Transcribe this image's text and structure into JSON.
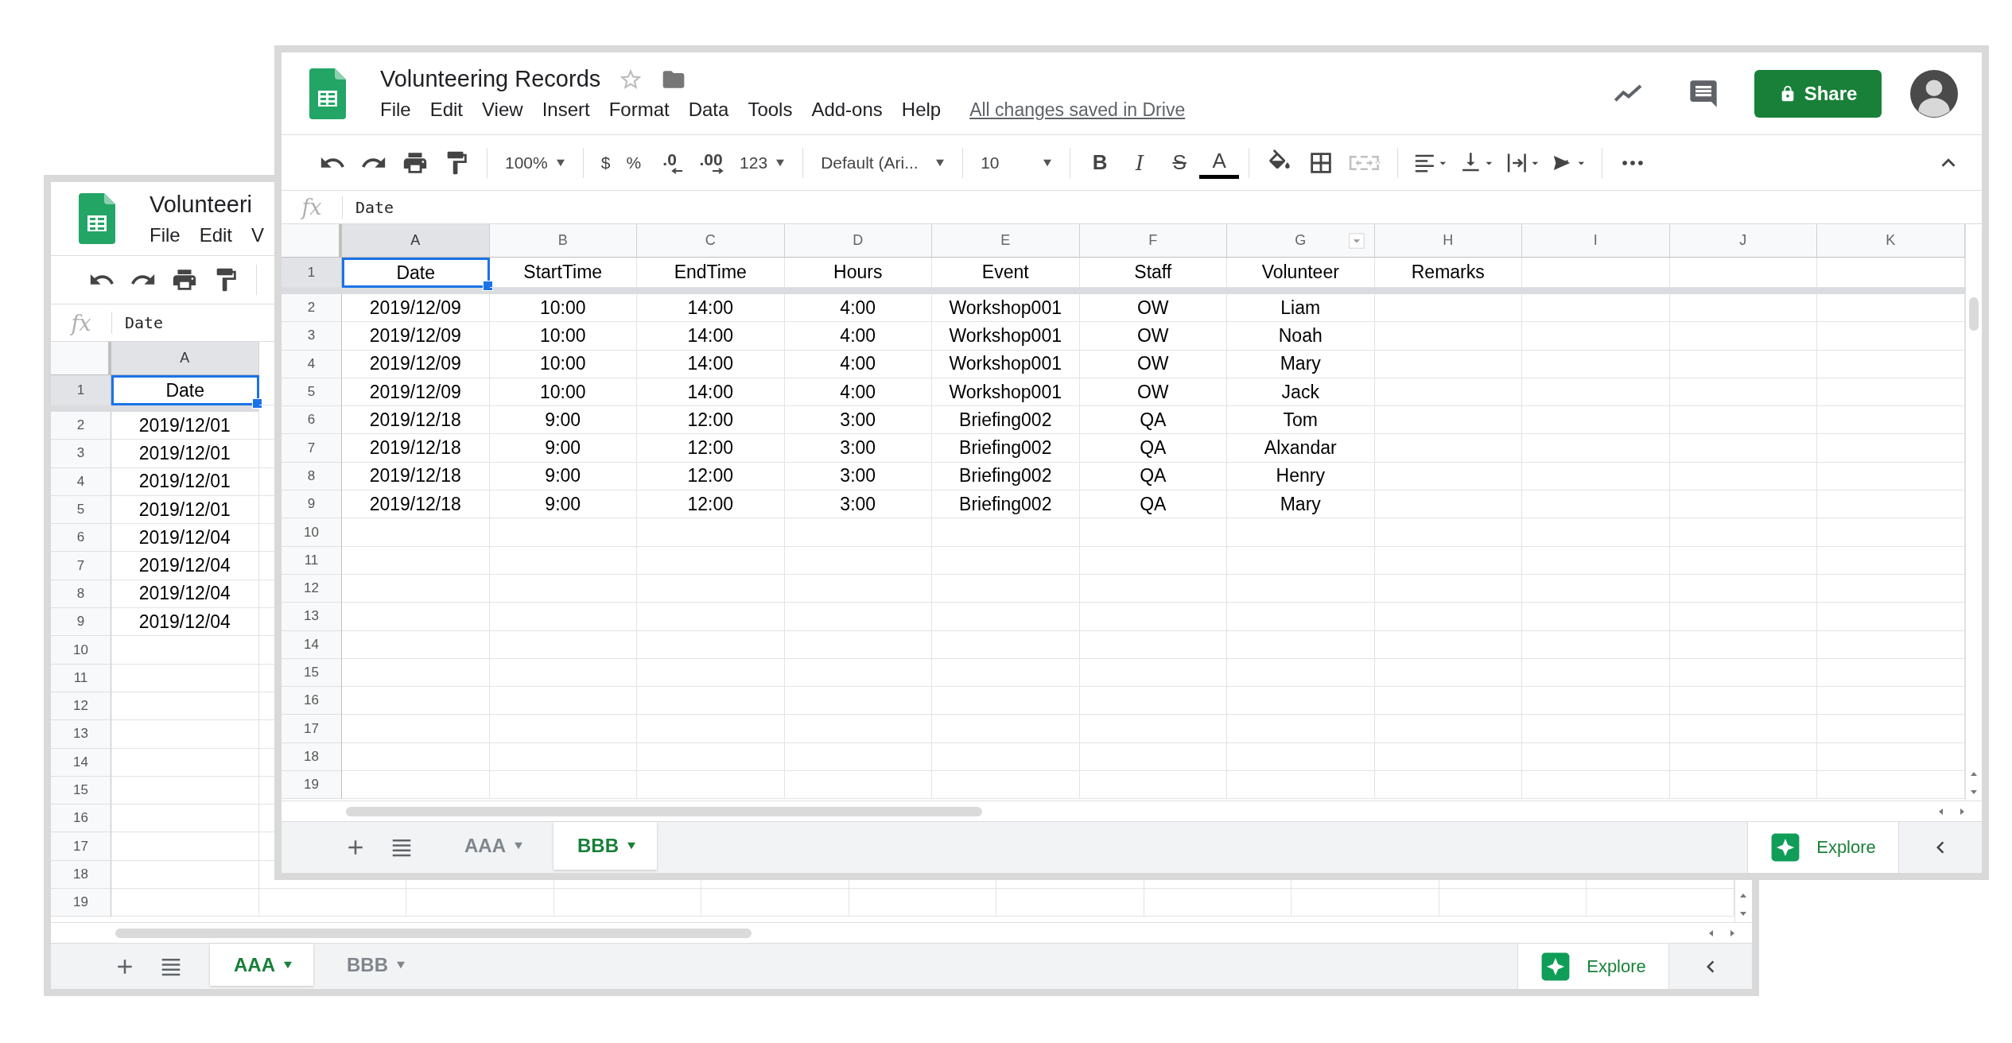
{
  "back_window": {
    "title": "Volunteeri",
    "menu": [
      "File",
      "Edit",
      "V"
    ],
    "formula_bar": {
      "label": "fx",
      "value": "Date"
    },
    "column_headers": [
      {
        "label": "A",
        "selected": true,
        "filter": false
      }
    ],
    "row_numbers": [
      {
        "label": "1",
        "selected": true
      },
      {
        "label": "2",
        "selected": false
      },
      {
        "label": "3",
        "selected": false
      },
      {
        "label": "4",
        "selected": false
      },
      {
        "label": "5",
        "selected": false
      },
      {
        "label": "6",
        "selected": false
      },
      {
        "label": "7",
        "selected": false
      },
      {
        "label": "8",
        "selected": false
      },
      {
        "label": "9",
        "selected": false
      },
      {
        "label": "10",
        "selected": false
      },
      {
        "label": "11",
        "selected": false
      },
      {
        "label": "12",
        "selected": false
      },
      {
        "label": "13",
        "selected": false
      },
      {
        "label": "14",
        "selected": false
      },
      {
        "label": "15",
        "selected": false
      },
      {
        "label": "16",
        "selected": false
      },
      {
        "label": "17",
        "selected": false
      },
      {
        "label": "18",
        "selected": false
      },
      {
        "label": "19",
        "selected": false
      }
    ],
    "rows": [
      [
        "Date"
      ],
      [
        "2019/12/01"
      ],
      [
        "2019/12/01"
      ],
      [
        "2019/12/01"
      ],
      [
        "2019/12/01"
      ],
      [
        "2019/12/04"
      ],
      [
        "2019/12/04"
      ],
      [
        "2019/12/04"
      ],
      [
        "2019/12/04"
      ]
    ],
    "sheet_tabs": [
      {
        "label": "AAA",
        "selected": true
      },
      {
        "label": "BBB",
        "selected": false
      }
    ],
    "explore": "Explore"
  },
  "front_window": {
    "title": "Volunteering Records",
    "menu": [
      "File",
      "Edit",
      "View",
      "Insert",
      "Format",
      "Data",
      "Tools",
      "Add-ons",
      "Help"
    ],
    "save_status": "All changes saved in Drive",
    "share_button": "Share",
    "toolbar": {
      "zoom": "100%",
      "currency": "$",
      "percent": "%",
      "decrease_decimal": ".0",
      "increase_decimal": ".00",
      "number_format": "123",
      "font": "Default (Ari...",
      "font_size": "10",
      "bold": "B",
      "italic": "I",
      "strikethrough": "S",
      "text_color": "A",
      "merge": {
        "disabled": true
      }
    },
    "formula_bar": {
      "label": "fx",
      "value": "Date"
    },
    "column_headers": [
      {
        "label": "A",
        "selected": true,
        "filter": false
      },
      {
        "label": "B",
        "selected": false,
        "filter": false
      },
      {
        "label": "C",
        "selected": false,
        "filter": false
      },
      {
        "label": "D",
        "selected": false,
        "filter": false
      },
      {
        "label": "E",
        "selected": false,
        "filter": false
      },
      {
        "label": "F",
        "selected": false,
        "filter": false
      },
      {
        "label": "G",
        "selected": false,
        "filter": true
      },
      {
        "label": "H",
        "selected": false,
        "filter": false
      },
      {
        "label": "I",
        "selected": false,
        "filter": false
      },
      {
        "label": "J",
        "selected": false,
        "filter": false
      },
      {
        "label": "K",
        "selected": false,
        "filter": false
      }
    ],
    "row_numbers": [
      {
        "label": "1",
        "selected": true
      },
      {
        "label": "2",
        "selected": false
      },
      {
        "label": "3",
        "selected": false
      },
      {
        "label": "4",
        "selected": false
      },
      {
        "label": "5",
        "selected": false
      },
      {
        "label": "6",
        "selected": false
      },
      {
        "label": "7",
        "selected": false
      },
      {
        "label": "8",
        "selected": false
      },
      {
        "label": "9",
        "selected": false
      },
      {
        "label": "10",
        "selected": false
      },
      {
        "label": "11",
        "selected": false
      },
      {
        "label": "12",
        "selected": false
      },
      {
        "label": "13",
        "selected": false
      },
      {
        "label": "14",
        "selected": false
      },
      {
        "label": "15",
        "selected": false
      },
      {
        "label": "16",
        "selected": false
      },
      {
        "label": "17",
        "selected": false
      },
      {
        "label": "18",
        "selected": false
      },
      {
        "label": "19",
        "selected": false
      }
    ],
    "rows": [
      [
        "Date",
        "StartTime",
        "EndTime",
        "Hours",
        "Event",
        "Staff",
        "Volunteer",
        "Remarks"
      ],
      [
        "2019/12/09",
        "10:00",
        "14:00",
        "4:00",
        "Workshop001",
        "OW",
        "Liam"
      ],
      [
        "2019/12/09",
        "10:00",
        "14:00",
        "4:00",
        "Workshop001",
        "OW",
        "Noah"
      ],
      [
        "2019/12/09",
        "10:00",
        "14:00",
        "4:00",
        "Workshop001",
        "OW",
        "Mary"
      ],
      [
        "2019/12/09",
        "10:00",
        "14:00",
        "4:00",
        "Workshop001",
        "OW",
        "Jack"
      ],
      [
        "2019/12/18",
        "9:00",
        "12:00",
        "3:00",
        "Briefing002",
        "QA",
        "Tom"
      ],
      [
        "2019/12/18",
        "9:00",
        "12:00",
        "3:00",
        "Briefing002",
        "QA",
        "Alxandar"
      ],
      [
        "2019/12/18",
        "9:00",
        "12:00",
        "3:00",
        "Briefing002",
        "QA",
        "Henry"
      ],
      [
        "2019/12/18",
        "9:00",
        "12:00",
        "3:00",
        "Briefing002",
        "QA",
        "Mary"
      ]
    ],
    "sheet_tabs": [
      {
        "label": "AAA",
        "selected": false
      },
      {
        "label": "BBB",
        "selected": true
      }
    ],
    "explore": "Explore"
  }
}
